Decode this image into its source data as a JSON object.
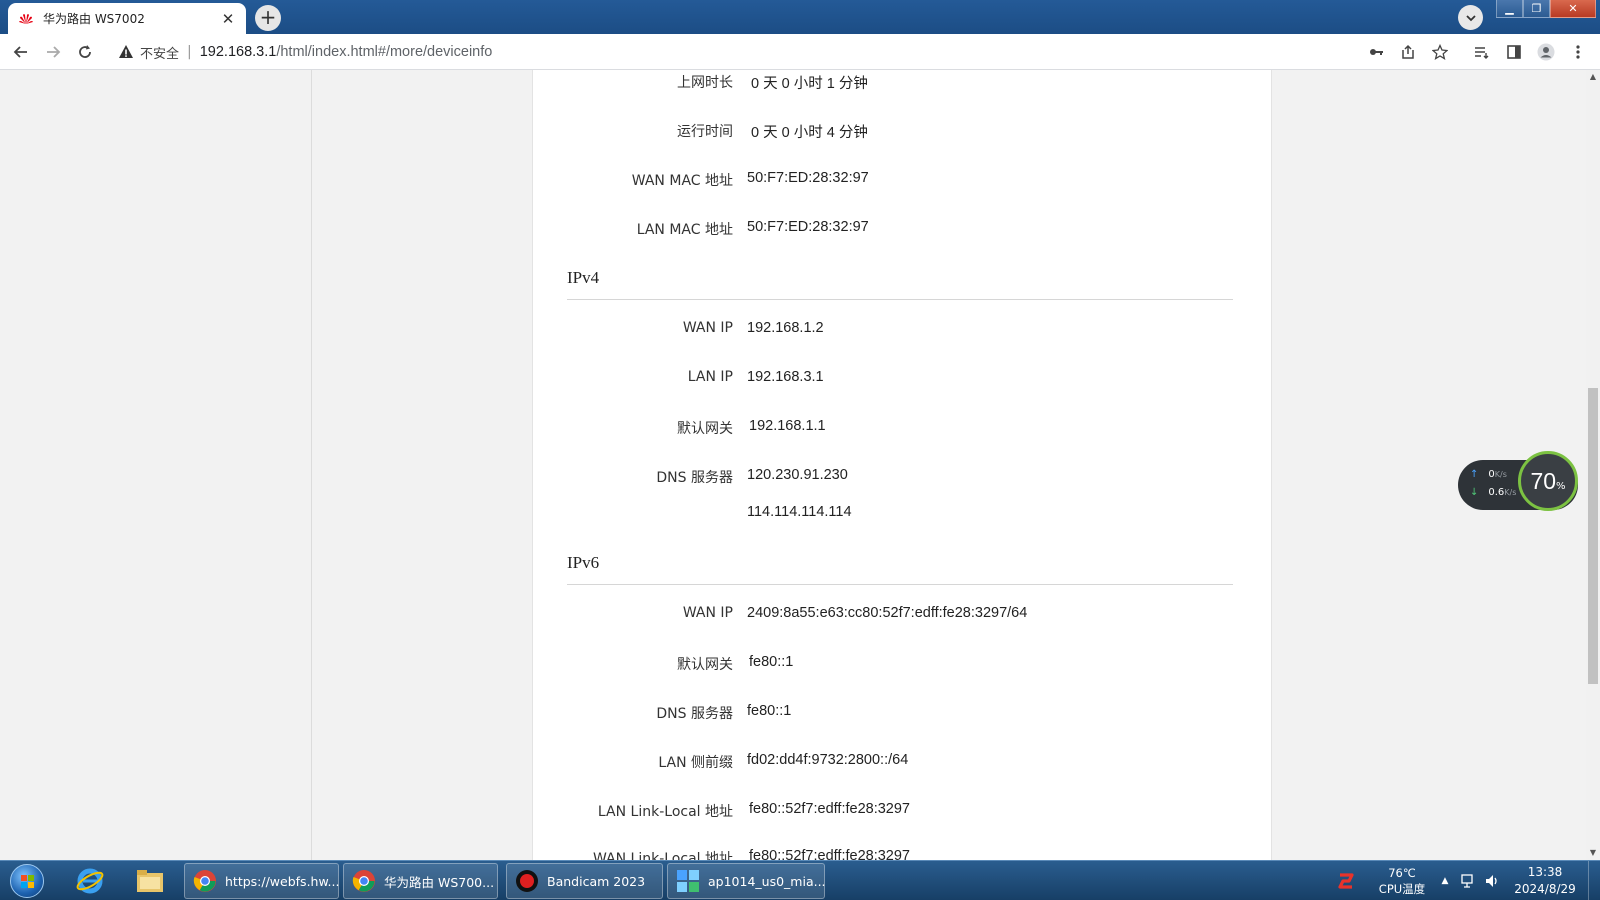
{
  "browser": {
    "tab_title": "华为路由 WS7002",
    "tab_close": "✕",
    "new_tab": "+",
    "security_label": "不安全",
    "url_host": "192.168.3.1",
    "url_path": "/html/index.html#/more/deviceinfo"
  },
  "device_info": {
    "rows_top": [
      {
        "label": "上网时长",
        "value": "0 天 0 小时 1 分钟"
      },
      {
        "label": "运行时间",
        "value": "0 天 0 小时 4 分钟"
      },
      {
        "label": "WAN MAC 地址",
        "value": "50:F7:ED:28:32:97"
      },
      {
        "label": "LAN MAC 地址",
        "value": "50:F7:ED:28:32:97"
      }
    ],
    "ipv4": {
      "title": "IPv4",
      "rows": [
        {
          "label": "WAN IP",
          "value": "192.168.1.2"
        },
        {
          "label": "LAN IP",
          "value": "192.168.3.1"
        },
        {
          "label": "默认网关",
          "value": "192.168.1.1"
        },
        {
          "label": "DNS 服务器",
          "value": "120.230.91.230"
        },
        {
          "label": "",
          "value": "114.114.114.114"
        }
      ]
    },
    "ipv6": {
      "title": "IPv6",
      "rows": [
        {
          "label": "WAN IP",
          "value": "2409:8a55:e63:cc80:52f7:edff:fe28:3297/64"
        },
        {
          "label": "默认网关",
          "value": "fe80::1"
        },
        {
          "label": "DNS 服务器",
          "value": "fe80::1"
        },
        {
          "label": "LAN 侧前缀",
          "value": "fd02:dd4f:9732:2800::/64"
        },
        {
          "label": "LAN Link-Local 地址",
          "value": "fe80::52f7:edff:fe28:3297"
        },
        {
          "label": "WAN Link-Local 地址",
          "value": "fe80::52f7:edff:fe28:3297"
        }
      ]
    }
  },
  "net_widget": {
    "upload": "0",
    "download": "0.6",
    "unit": "K/s",
    "cpu_percent": "70",
    "percent_sign": "%"
  },
  "taskbar": {
    "items": [
      {
        "label": "https://webfs.hw...",
        "icon": "chrome-icon"
      },
      {
        "label": "华为路由 WS700...",
        "icon": "chrome-icon"
      },
      {
        "label": "Bandicam 2023",
        "icon": "record-icon"
      },
      {
        "label": "ap1014_us0_mia...",
        "icon": "app-icon"
      }
    ],
    "temp": "76℃",
    "temp_label": "CPU温度",
    "time": "13:38",
    "date": "2024/8/29"
  },
  "colors": {
    "chrome_blue": "#1c4d85",
    "taskbar": "#1f4b78",
    "cpu_ring": "#7cc242"
  }
}
